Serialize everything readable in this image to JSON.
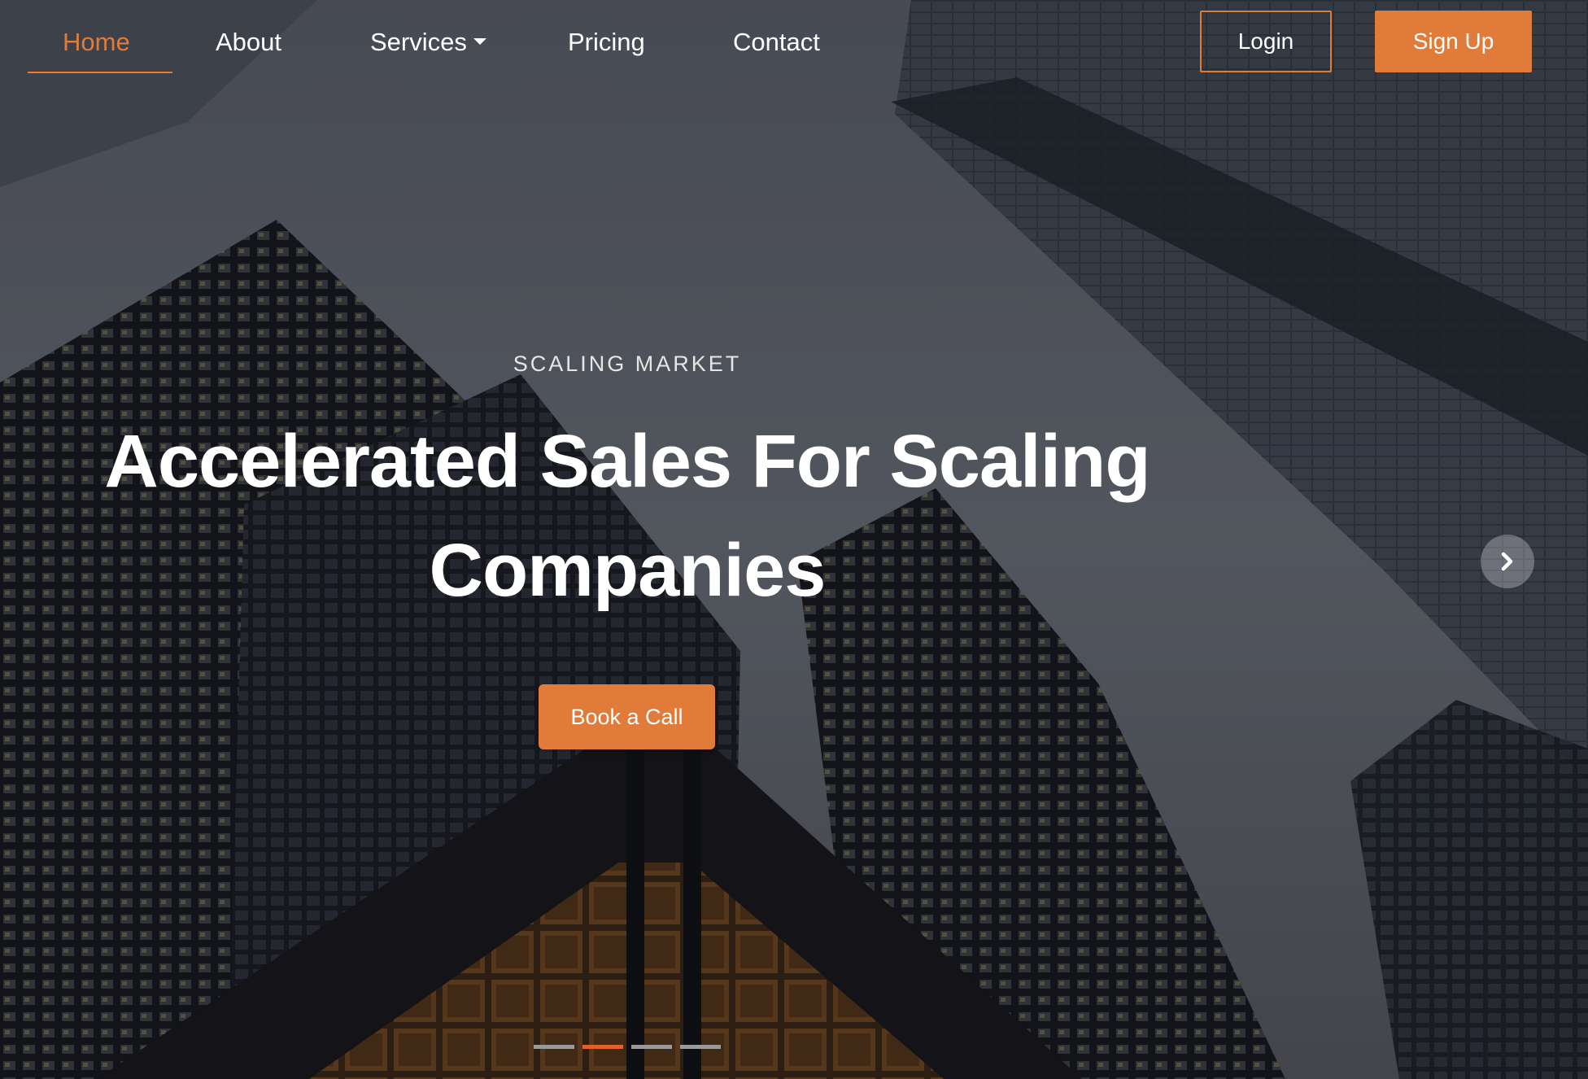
{
  "nav": {
    "items": [
      {
        "label": "Home",
        "active": true
      },
      {
        "label": "About",
        "active": false
      },
      {
        "label": "Services",
        "active": false,
        "has_dropdown": true
      },
      {
        "label": "Pricing",
        "active": false
      },
      {
        "label": "Contact",
        "active": false
      }
    ],
    "login_label": "Login",
    "signup_label": "Sign Up"
  },
  "hero": {
    "eyebrow": "SCALING MARKET",
    "headline_line1": "Accelerated Sales For Scaling",
    "headline_line2": "Companies",
    "cta_label": "Book a Call",
    "background": "city-skyscrapers-photo"
  },
  "carousel": {
    "slide_count": 4,
    "active_index": 1,
    "next_icon": "chevron-right-icon"
  },
  "colors": {
    "accent": "#e07b39",
    "indicator_active": "#e0622b",
    "text": "#ffffff"
  }
}
